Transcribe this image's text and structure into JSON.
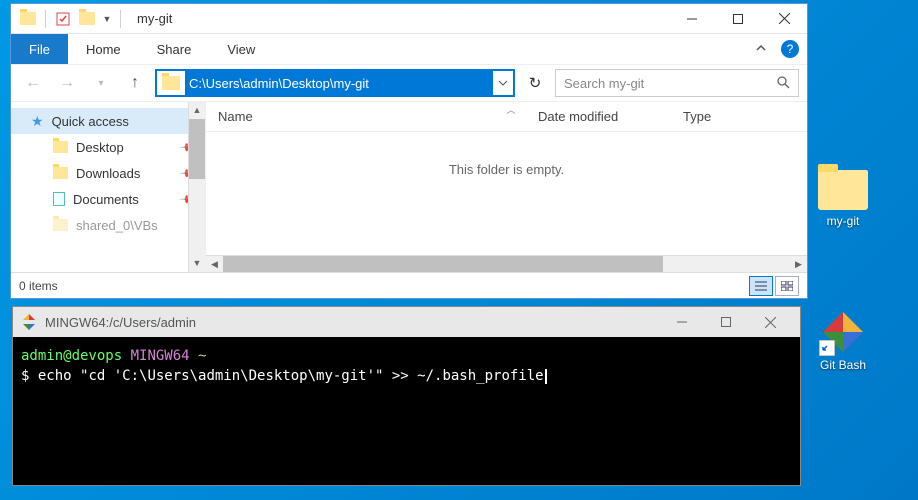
{
  "explorer": {
    "title": "my-git",
    "file_tab": "File",
    "tabs": [
      "Home",
      "Share",
      "View"
    ],
    "address_path": "C:\\Users\\admin\\Desktop\\my-git",
    "search_placeholder": "Search my-git",
    "nav_pane": {
      "quick_access": "Quick access",
      "items": [
        {
          "label": "Desktop",
          "icon": "folder"
        },
        {
          "label": "Downloads",
          "icon": "folder"
        },
        {
          "label": "Documents",
          "icon": "document"
        },
        {
          "label": "shared_0\\VBs",
          "icon": "folder"
        }
      ]
    },
    "columns": {
      "name": "Name",
      "date": "Date modified",
      "type": "Type"
    },
    "empty_message": "This folder is empty.",
    "status": "0 items"
  },
  "terminal": {
    "title": "MINGW64:/c/Users/admin",
    "prompt_user": "admin@devops",
    "prompt_env": "MINGW64",
    "prompt_path": "~",
    "prompt_symbol": "$",
    "command": "echo \"cd 'C:\\Users\\admin\\Desktop\\my-git'\" >> ~/.bash_profile"
  },
  "desktop": {
    "folder_label": "my-git",
    "gitbash_label": "Git Bash"
  }
}
